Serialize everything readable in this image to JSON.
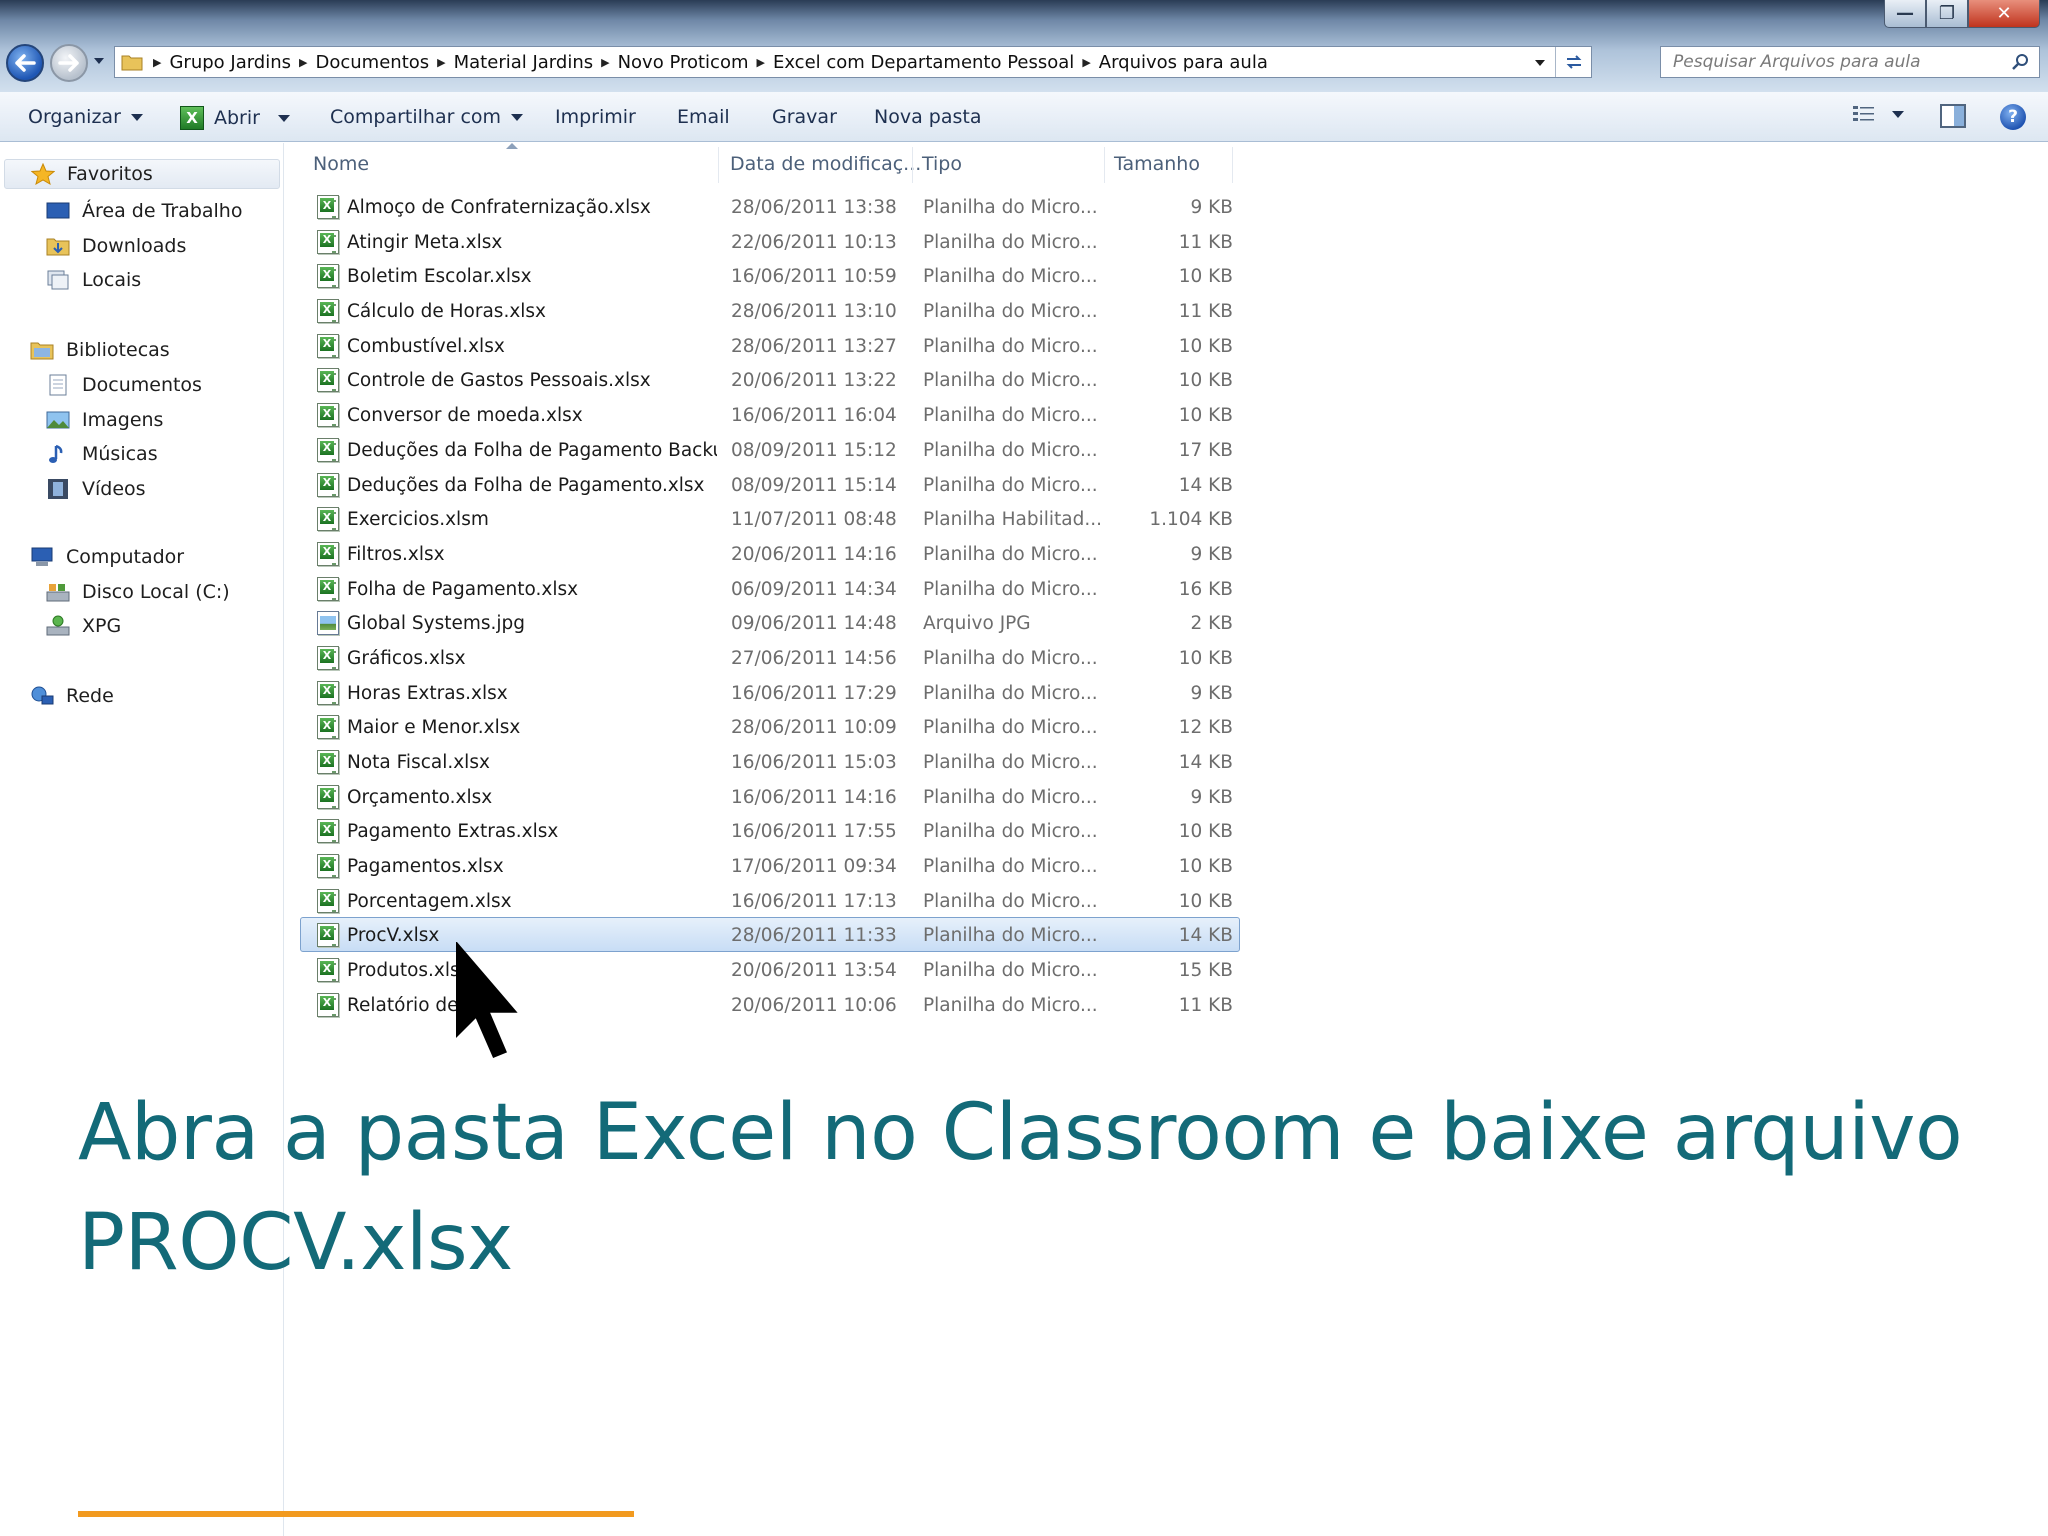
{
  "window": {
    "buttons": {
      "minimize": "—",
      "maximize": "❐",
      "close": "✕"
    }
  },
  "address_bar": {
    "breadcrumbs": [
      "Grupo Jardins",
      "Documentos",
      "Material Jardins",
      "Novo Proticom",
      "Excel com Departamento Pessoal",
      "Arquivos para aula"
    ]
  },
  "search": {
    "placeholder": "Pesquisar Arquivos para aula"
  },
  "toolbar": {
    "organize": "Organizar",
    "open": "Abrir",
    "share": "Compartilhar com",
    "print": "Imprimir",
    "email": "Email",
    "burn": "Gravar",
    "new_folder": "Nova pasta",
    "help": "?"
  },
  "nav": {
    "favorites": "Favoritos",
    "desktop": "Área de Trabalho",
    "downloads": "Downloads",
    "places": "Locais",
    "libraries": "Bibliotecas",
    "documents": "Documentos",
    "images": "Imagens",
    "music": "Músicas",
    "videos": "Vídeos",
    "computer": "Computador",
    "local_disk": "Disco Local (C:)",
    "xpg": "XPG",
    "network": "Rede"
  },
  "columns": {
    "name": "Nome",
    "date": "Data de modificaç...",
    "type": "Tipo",
    "size": "Tamanho"
  },
  "files": [
    {
      "name": "Almoço de Confraternização.xlsx",
      "date": "28/06/2011 13:38",
      "type": "Planilha do Micro...",
      "size": "9 KB",
      "icon": "excel"
    },
    {
      "name": "Atingir Meta.xlsx",
      "date": "22/06/2011 10:13",
      "type": "Planilha do Micro...",
      "size": "11 KB",
      "icon": "excel"
    },
    {
      "name": "Boletim Escolar.xlsx",
      "date": "16/06/2011 10:59",
      "type": "Planilha do Micro...",
      "size": "10 KB",
      "icon": "excel"
    },
    {
      "name": "Cálculo de Horas.xlsx",
      "date": "28/06/2011 13:10",
      "type": "Planilha do Micro...",
      "size": "11 KB",
      "icon": "excel"
    },
    {
      "name": "Combustível.xlsx",
      "date": "28/06/2011 13:27",
      "type": "Planilha do Micro...",
      "size": "10 KB",
      "icon": "excel"
    },
    {
      "name": "Controle de Gastos Pessoais.xlsx",
      "date": "20/06/2011 13:22",
      "type": "Planilha do Micro...",
      "size": "10 KB",
      "icon": "excel"
    },
    {
      "name": "Conversor de moeda.xlsx",
      "date": "16/06/2011 16:04",
      "type": "Planilha do Micro...",
      "size": "10 KB",
      "icon": "excel"
    },
    {
      "name": "Deduções da Folha de Pagamento Backu...",
      "date": "08/09/2011 15:12",
      "type": "Planilha do Micro...",
      "size": "17 KB",
      "icon": "excel"
    },
    {
      "name": "Deduções da Folha de Pagamento.xlsx",
      "date": "08/09/2011 15:14",
      "type": "Planilha do Micro...",
      "size": "14 KB",
      "icon": "excel"
    },
    {
      "name": "Exercicios.xlsm",
      "date": "11/07/2011 08:48",
      "type": "Planilha Habilitad...",
      "size": "1.104 KB",
      "icon": "excel"
    },
    {
      "name": "Filtros.xlsx",
      "date": "20/06/2011 14:16",
      "type": "Planilha do Micro...",
      "size": "9 KB",
      "icon": "excel"
    },
    {
      "name": "Folha de Pagamento.xlsx",
      "date": "06/09/2011 14:34",
      "type": "Planilha do Micro...",
      "size": "16 KB",
      "icon": "excel"
    },
    {
      "name": "Global Systems.jpg",
      "date": "09/06/2011 14:48",
      "type": "Arquivo JPG",
      "size": "2 KB",
      "icon": "image"
    },
    {
      "name": "Gráficos.xlsx",
      "date": "27/06/2011 14:56",
      "type": "Planilha do Micro...",
      "size": "10 KB",
      "icon": "excel"
    },
    {
      "name": "Horas Extras.xlsx",
      "date": "16/06/2011 17:29",
      "type": "Planilha do Micro...",
      "size": "9 KB",
      "icon": "excel"
    },
    {
      "name": "Maior e Menor.xlsx",
      "date": "28/06/2011 10:09",
      "type": "Planilha do Micro...",
      "size": "12 KB",
      "icon": "excel"
    },
    {
      "name": "Nota Fiscal.xlsx",
      "date": "16/06/2011 15:03",
      "type": "Planilha do Micro...",
      "size": "14 KB",
      "icon": "excel"
    },
    {
      "name": "Orçamento.xlsx",
      "date": "16/06/2011 14:16",
      "type": "Planilha do Micro...",
      "size": "9 KB",
      "icon": "excel"
    },
    {
      "name": "Pagamento Extras.xlsx",
      "date": "16/06/2011 17:55",
      "type": "Planilha do Micro...",
      "size": "10 KB",
      "icon": "excel"
    },
    {
      "name": "Pagamentos.xlsx",
      "date": "17/06/2011 09:34",
      "type": "Planilha do Micro...",
      "size": "10 KB",
      "icon": "excel"
    },
    {
      "name": "Porcentagem.xlsx",
      "date": "16/06/2011 17:13",
      "type": "Planilha do Micro...",
      "size": "10 KB",
      "icon": "excel"
    },
    {
      "name": "ProcV.xlsx",
      "date": "28/06/2011 11:33",
      "type": "Planilha do Micro...",
      "size": "14 KB",
      "icon": "excel",
      "selected": true
    },
    {
      "name": "Produtos.xlsx",
      "date": "20/06/2011 13:54",
      "type": "Planilha do Micro...",
      "size": "15 KB",
      "icon": "excel"
    },
    {
      "name": "Relatório de ...x",
      "date": "20/06/2011 10:06",
      "type": "Planilha do Micro...",
      "size": "11 KB",
      "icon": "excel"
    }
  ],
  "caption": {
    "line1": "Abra a pasta Excel no Classroom e baixe arquivo",
    "line2": "PROCV.xlsx"
  },
  "colors": {
    "caption": "#136a78",
    "accent_line": "#f29a1f",
    "selection": "#c8ddf5"
  }
}
